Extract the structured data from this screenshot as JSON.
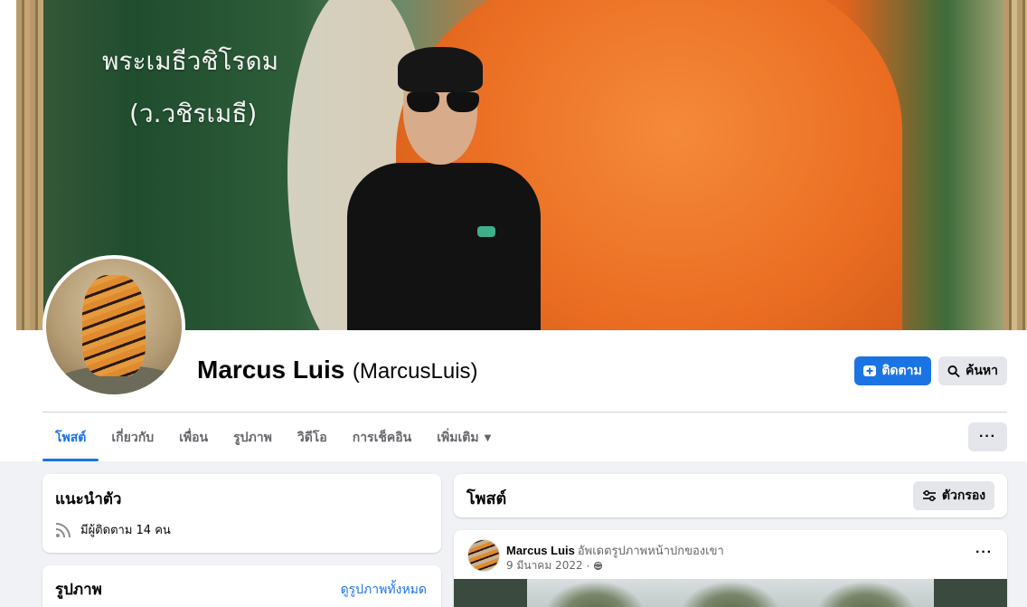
{
  "cover": {
    "text_line1": "พระเมธีวชิโรดม",
    "text_line2": "(ว.วชิรเมธี)"
  },
  "profile": {
    "name": "Marcus Luis",
    "username": "(MarcusLuis)",
    "follow_label": "ติดตาม",
    "search_label": "ค้นหา"
  },
  "tabs": [
    {
      "label": "โพสต์",
      "active": true
    },
    {
      "label": "เกี่ยวกับ",
      "active": false
    },
    {
      "label": "เพื่อน",
      "active": false
    },
    {
      "label": "รูปภาพ",
      "active": false
    },
    {
      "label": "วิดีโอ",
      "active": false
    },
    {
      "label": "การเช็คอิน",
      "active": false
    },
    {
      "label": "เพิ่มเติม",
      "active": false
    }
  ],
  "more_label": "···",
  "intro": {
    "title": "แนะนำตัว",
    "followers": "มีผู้ติดตาม 14 คน"
  },
  "photos": {
    "title": "รูปภาพ",
    "see_all": "ดูรูปภาพทั้งหมด"
  },
  "posts": {
    "title": "โพสต์",
    "filter_label": "ตัวกรอง"
  },
  "post": {
    "author": "Marcus Luis",
    "action": "อัพเดตรูปภาพหน้าปกของเขา",
    "date": "9 มีนาคม 2022",
    "separator": "·",
    "menu": "···"
  },
  "colors": {
    "accent": "#1b74e4",
    "background": "#f0f2f5",
    "secondary_text": "#65676b"
  }
}
